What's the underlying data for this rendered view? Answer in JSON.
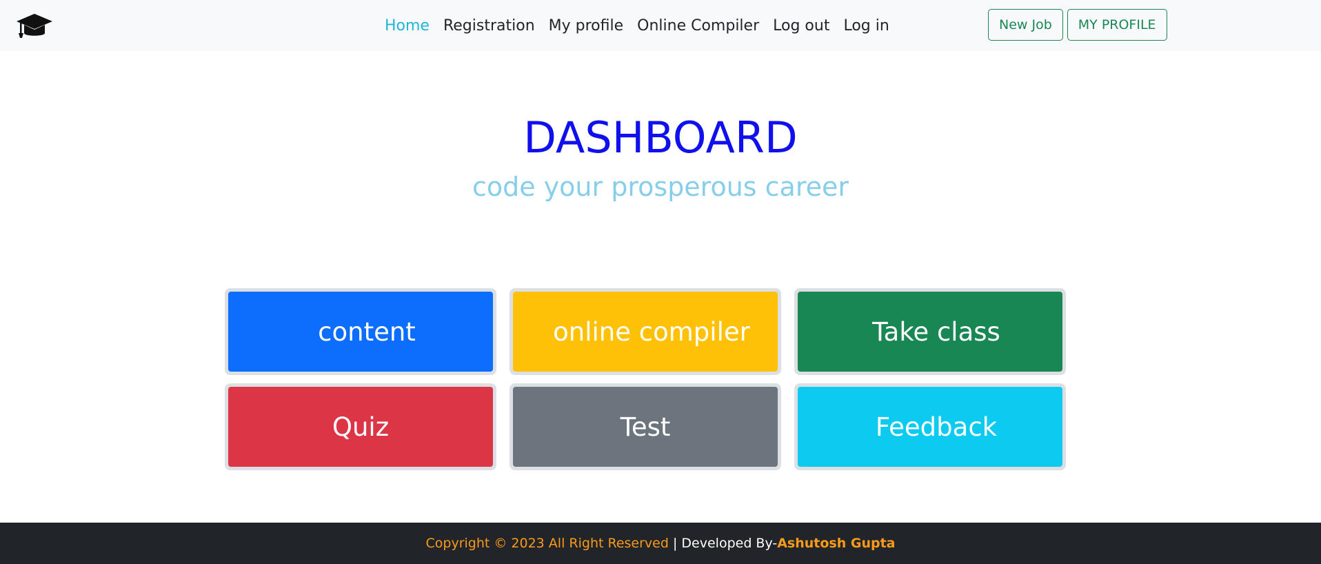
{
  "navbar": {
    "brand_icon": "graduation-cap-icon",
    "links": [
      {
        "label": "Home",
        "active": true
      },
      {
        "label": "Registration",
        "active": false
      },
      {
        "label": "My profile",
        "active": false
      },
      {
        "label": "Online Compiler",
        "active": false
      },
      {
        "label": "Log out",
        "active": false
      },
      {
        "label": "Log in",
        "active": false
      }
    ],
    "buttons": {
      "new_job": "New Job",
      "my_profile": "MY PROFILE"
    }
  },
  "hero": {
    "title": "DASHBOARD",
    "subtitle": "code your prosperous career"
  },
  "tiles": [
    {
      "label": "content",
      "color": "#0d6efd"
    },
    {
      "label": "online compiler",
      "color": "#ffc107"
    },
    {
      "label": "Take class",
      "color": "#198754"
    },
    {
      "label": "Quiz",
      "color": "#dc3545"
    },
    {
      "label": "Test",
      "color": "#6c757d"
    },
    {
      "label": "Feedback",
      "color": "#0dcaf0"
    }
  ],
  "footer": {
    "copyright": "Copyright © 2023 All Right Reserved",
    "separator": " | ",
    "developed_by": "Developed By-",
    "developer": "Ashutosh Gupta"
  },
  "colors": {
    "accent_link": "#1fb6d8",
    "title": "#1010ee",
    "subtitle": "#87ceeb",
    "outline_button": "#198754",
    "footer_bg": "#212529",
    "footer_highlight": "#fd9a1a"
  }
}
